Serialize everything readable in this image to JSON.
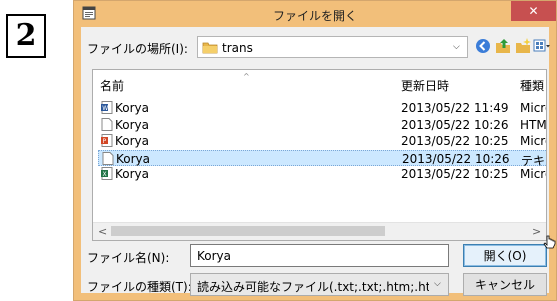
{
  "step_number": "2",
  "window": {
    "title": "ファイルを開く",
    "close_glyph": "✕",
    "app_icon": "app-window-icon"
  },
  "look_in": {
    "label": "ファイルの場所(I):",
    "value": "trans",
    "icon": "folder-icon"
  },
  "toolbar": [
    {
      "name": "back-icon"
    },
    {
      "name": "up-folder-icon"
    },
    {
      "name": "new-folder-icon"
    },
    {
      "name": "view-menu-icon"
    }
  ],
  "columns": [
    "名前",
    "更新日時",
    "種類"
  ],
  "files": [
    {
      "name": "Korya",
      "date": "2013/05/22 11:49",
      "type": "Micro",
      "icon": "word-doc-icon",
      "color": "#2b579a",
      "selected": false
    },
    {
      "name": "Korya",
      "date": "2013/05/22 10:26",
      "type": "HTM",
      "icon": "html-file-icon",
      "color": "#ffffff",
      "selected": false
    },
    {
      "name": "Korya",
      "date": "2013/05/22 10:25",
      "type": "Micro",
      "icon": "powerpoint-icon",
      "color": "#d24726",
      "selected": false
    },
    {
      "name": "Korya",
      "date": "2013/05/22 10:26",
      "type": "テキス",
      "icon": "text-file-icon",
      "color": "#ffffff",
      "selected": true
    },
    {
      "name": "Korya",
      "date": "2013/05/22 10:25",
      "type": "Micro",
      "icon": "excel-icon",
      "color": "#217346",
      "selected": false
    }
  ],
  "scroll": {
    "left": "<",
    "right": ">"
  },
  "file_name": {
    "label": "ファイル名(N):",
    "value": "Korya"
  },
  "file_type": {
    "label": "ファイルの種類(T):",
    "value": "読み込み可能なファイル(.txt;.txt;.htm;.html;."
  },
  "buttons": {
    "open": "開く(O)",
    "cancel": "キャンセル"
  },
  "colors": {
    "title_bar": "#f2bf7a",
    "close": "#c75050",
    "selection": "#cce8ff"
  }
}
